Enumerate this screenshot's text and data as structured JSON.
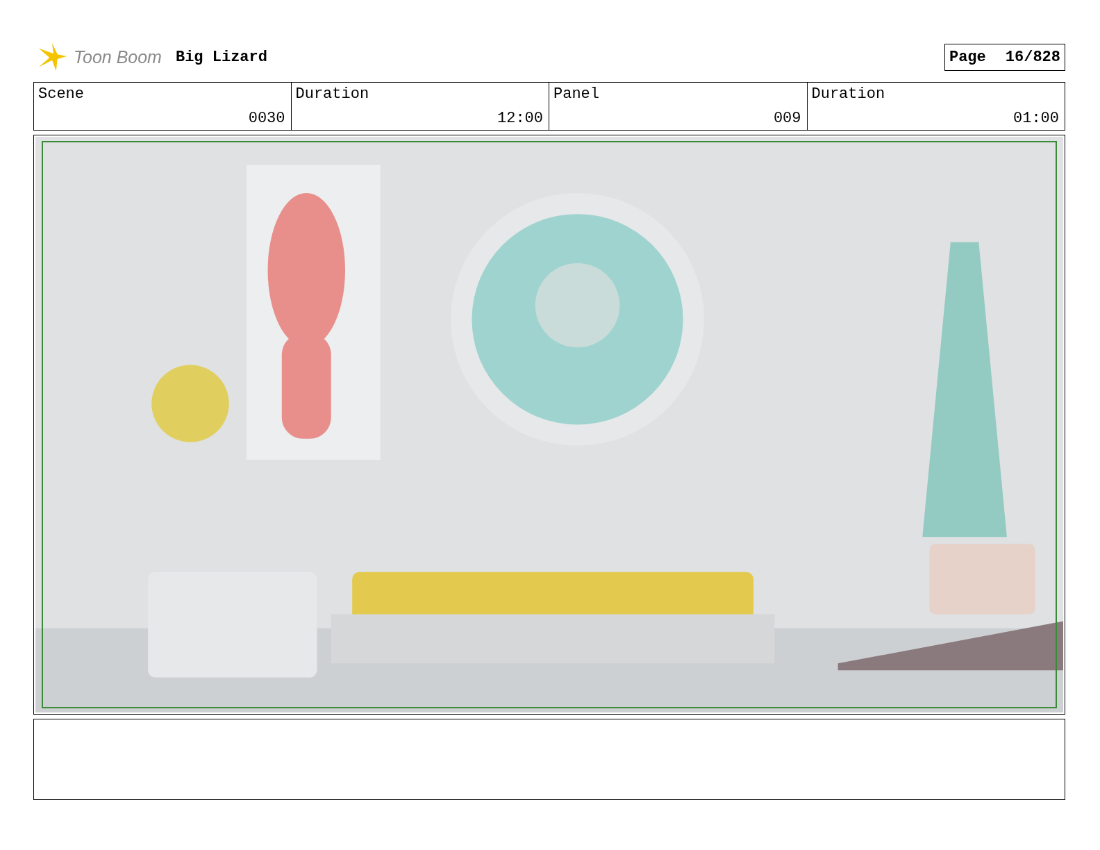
{
  "header": {
    "logo_text": "Toon Boom",
    "title": "Big Lizard",
    "page_label": "Page",
    "page_number": "16/828"
  },
  "info_table": {
    "columns": [
      "Scene",
      "Duration",
      "Panel",
      "Duration"
    ],
    "rows": [
      [
        "0030",
        "12:00",
        "009",
        "01:00"
      ]
    ]
  },
  "panel": {
    "picture": {
      "kind": "room-picture"
    }
  }
}
